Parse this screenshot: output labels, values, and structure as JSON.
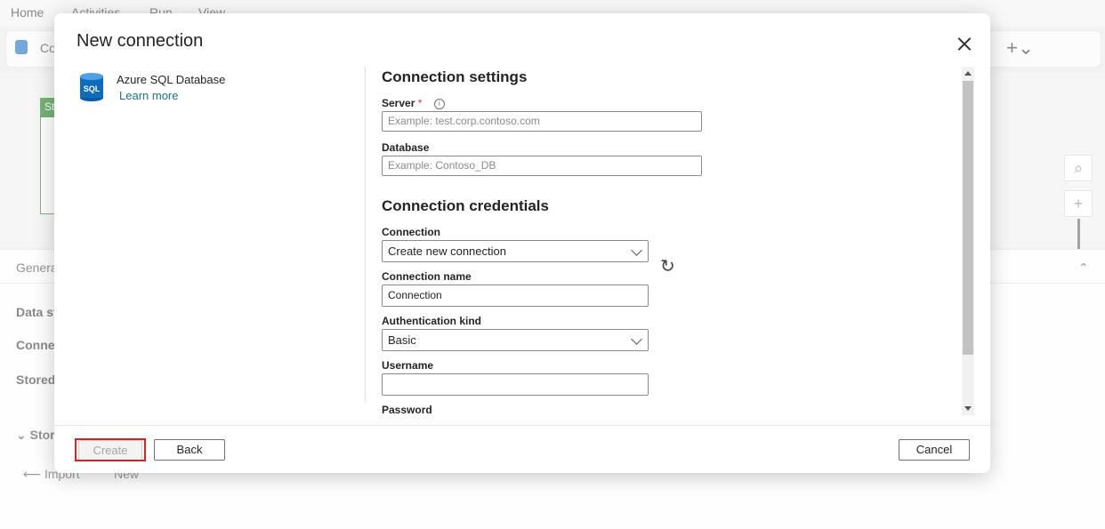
{
  "background": {
    "menu": [
      "Home",
      "Activities",
      "Run",
      "View"
    ],
    "toolbar_item": "Co",
    "activity_card_label": "St",
    "props_tab": "Genera",
    "props_rows": [
      "Data st",
      "Connec",
      "Stored"
    ],
    "section": "Stor",
    "import_label": "Import",
    "new_label": "New"
  },
  "dialog": {
    "title": "New connection",
    "connector": {
      "name": "Azure SQL Database",
      "icon_text": "SQL",
      "learn_more": "Learn more"
    },
    "settings": {
      "heading": "Connection settings",
      "server_label": "Server",
      "server_required": "*",
      "server_placeholder": "Example: test.corp.contoso.com",
      "database_label": "Database",
      "database_placeholder": "Example: Contoso_DB"
    },
    "credentials": {
      "heading": "Connection credentials",
      "connection_label": "Connection",
      "connection_value": "Create new connection",
      "connection_name_label": "Connection name",
      "connection_name_value": "Connection",
      "auth_label": "Authentication kind",
      "auth_value": "Basic",
      "username_label": "Username",
      "username_value": "",
      "password_label": "Password"
    },
    "footer": {
      "create": "Create",
      "back": "Back",
      "cancel": "Cancel"
    }
  }
}
